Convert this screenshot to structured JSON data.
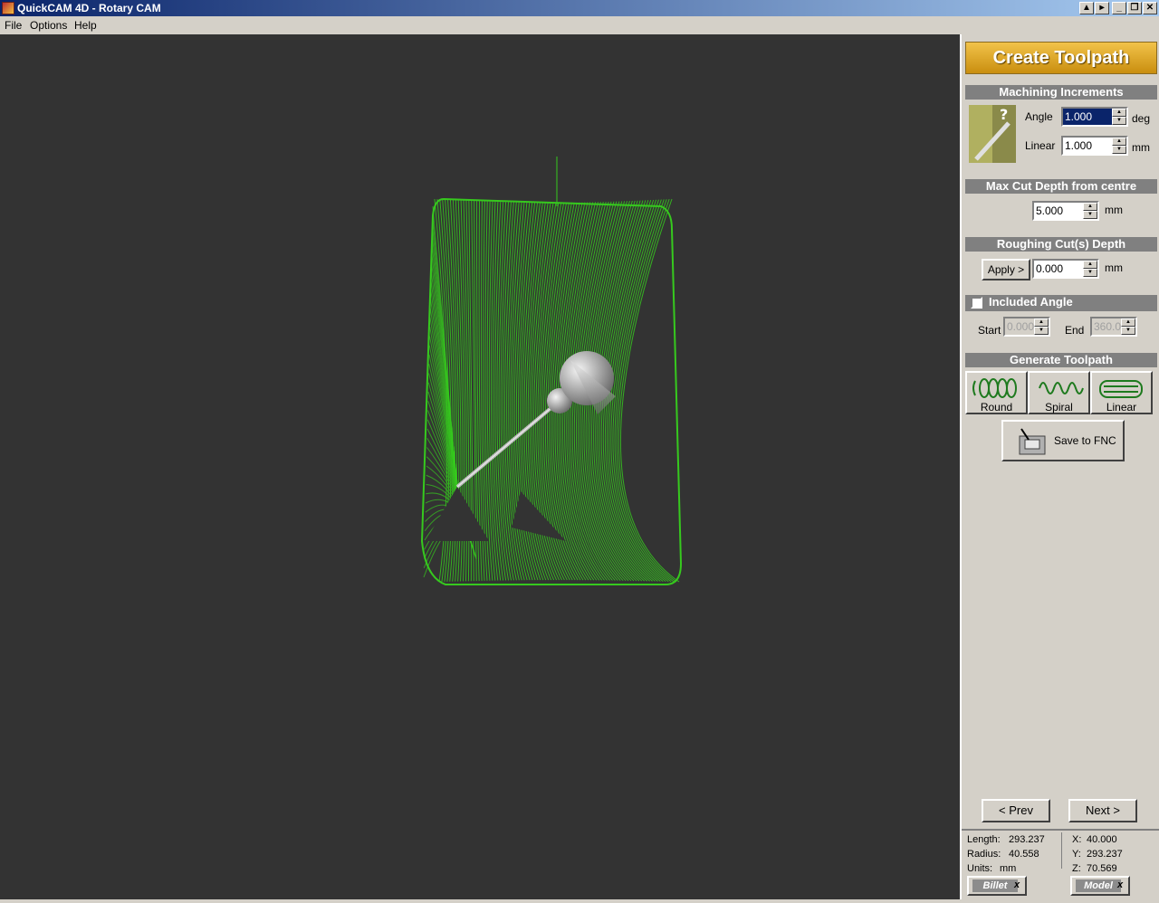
{
  "window": {
    "title": "QuickCAM 4D - Rotary CAM"
  },
  "menu": {
    "file": "File",
    "options": "Options",
    "help": "Help"
  },
  "panel": {
    "banner": "Create Toolpath",
    "machining": {
      "header": "Machining Increments",
      "angle_label": "Angle",
      "angle_value": "1.000",
      "angle_unit": "deg",
      "linear_label": "Linear",
      "linear_value": "1.000",
      "linear_unit": "mm"
    },
    "max_cut": {
      "header": "Max Cut Depth from centre",
      "value": "5.000",
      "unit": "mm"
    },
    "roughing": {
      "header": "Roughing Cut(s) Depth",
      "apply_label": "Apply >",
      "value": "0.000",
      "unit": "mm"
    },
    "included_angle": {
      "header": "Included Angle",
      "checked": false,
      "start_label": "Start",
      "start_value": "0.000",
      "end_label": "End",
      "end_value": "360.0"
    },
    "generate": {
      "header": "Generate Toolpath",
      "round": "Round",
      "spiral": "Spiral",
      "linear": "Linear",
      "save": "Save to FNC"
    },
    "nav": {
      "prev": "< Prev",
      "next": "Next >"
    },
    "status": {
      "length_label": "Length:",
      "length_value": "293.237",
      "radius_label": "Radius:",
      "radius_value": "40.558",
      "units_label": "Units:",
      "units_value": "mm",
      "x_label": "X:",
      "x_value": "40.000",
      "y_label": "Y:",
      "y_value": "293.237",
      "z_label": "Z:",
      "z_value": "70.569"
    },
    "tabs": {
      "billet": "Billet",
      "model": "Model",
      "close": "x"
    }
  },
  "colors": {
    "viewport_bg": "#333333",
    "toolpath": "#36c91e",
    "panel_bg": "#d4d0c8",
    "banner": "#d9a52a"
  }
}
